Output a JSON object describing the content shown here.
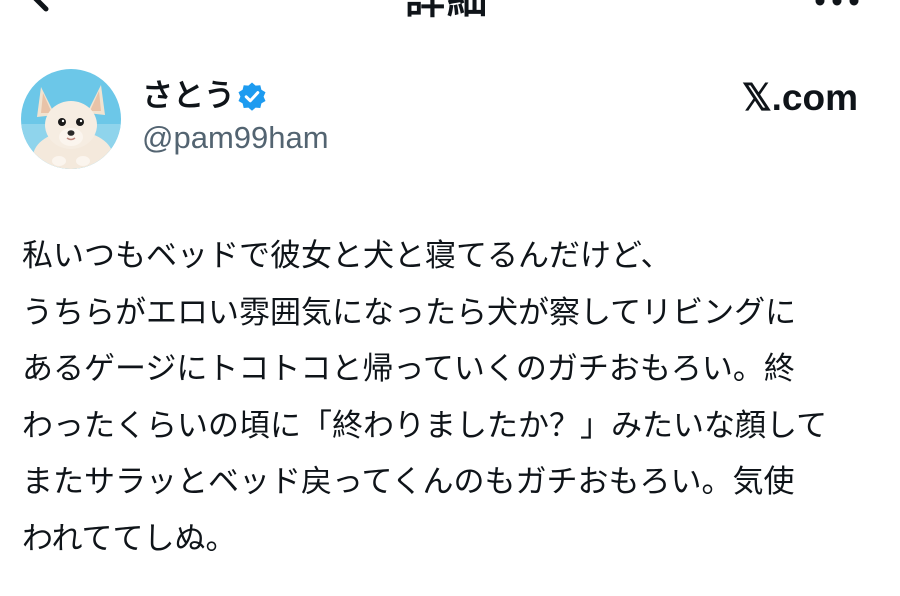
{
  "header": {
    "title": "詳細",
    "back_icon": "arrow-left-icon",
    "more_icon": "more-horizontal-icon"
  },
  "author": {
    "display_name": "さとう",
    "handle": "@pam99ham",
    "verified": true,
    "verified_color": "#1d9bf0",
    "avatar": "chihuahua-photo-avatar"
  },
  "site_logo": "𝕏.com",
  "tweet": {
    "lines": [
      "私いつもベッドで彼女と犬と寝てるんだけど、",
      "うちらがエロい雰囲気になったら犬が察してリビングに",
      "あるゲージにトコトコと帰っていくのガチおもろい。終",
      "わったくらいの頃に「終わりましたか？」みたいな顔して",
      "またサラッとベッド戻ってくんのもガチおもろい。気使",
      "われててしぬ。"
    ]
  },
  "colors": {
    "text": "#0f1419",
    "secondary_text": "#536471",
    "background": "#ffffff"
  }
}
